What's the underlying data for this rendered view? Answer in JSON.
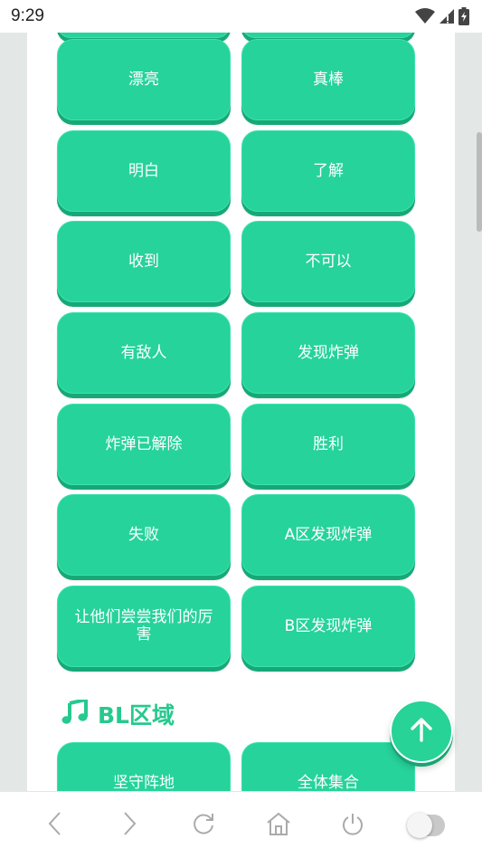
{
  "status_bar": {
    "time": "9:29",
    "icons": [
      "wifi-icon",
      "cell-signal-icon",
      "battery-charging-icon"
    ]
  },
  "section_top": {
    "buttons": [
      {
        "label": ""
      },
      {
        "label": ""
      },
      {
        "label": "漂亮"
      },
      {
        "label": "真棒"
      },
      {
        "label": "明白"
      },
      {
        "label": "了解"
      },
      {
        "label": "收到"
      },
      {
        "label": "不可以"
      },
      {
        "label": "有敌人"
      },
      {
        "label": "发现炸弹"
      },
      {
        "label": "炸弹已解除"
      },
      {
        "label": "胜利"
      },
      {
        "label": "失败"
      },
      {
        "label": "A区发现炸弹"
      },
      {
        "label": "让他们尝尝我们的厉害"
      },
      {
        "label": "B区发现炸弹"
      }
    ]
  },
  "section_bl": {
    "icon": "music-note-icon",
    "title": "BL区域",
    "buttons": [
      {
        "label": "坚守阵地"
      },
      {
        "label": "全体集合"
      }
    ]
  },
  "fab": {
    "icon": "arrow-up-icon"
  },
  "nav_bar": {
    "items": [
      "back-icon",
      "forward-icon",
      "reload-icon",
      "home-icon",
      "power-icon",
      "toggle-switch"
    ]
  },
  "colors": {
    "tile": "#26d39a",
    "tile_shadow": "#17a877",
    "heading": "#27c98f",
    "background": "#e3e8e6"
  }
}
